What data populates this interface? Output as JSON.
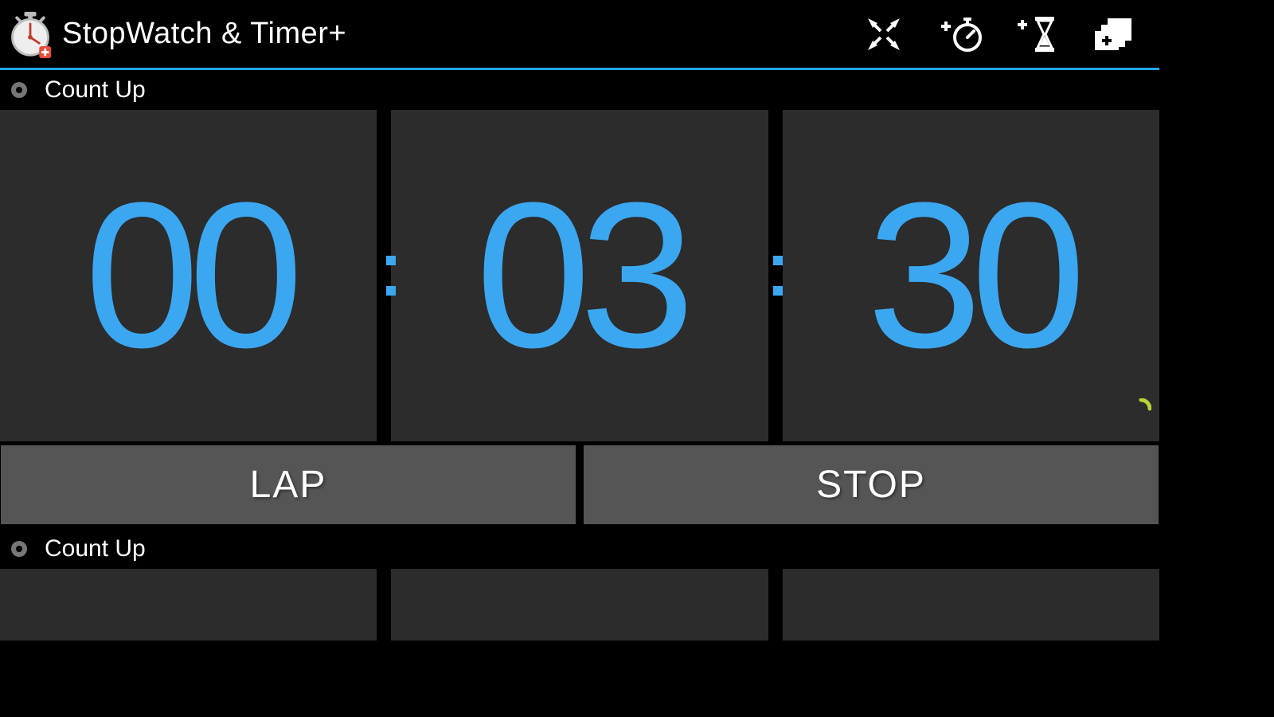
{
  "app": {
    "title": "StopWatch & Timer+",
    "accent": "#1fa6e8",
    "digit_color": "#3aa7f0"
  },
  "actions": {
    "collapse_icon": "collapse",
    "add_stopwatch_icon": "add-stopwatch",
    "add_timer_icon": "add-timer",
    "add_panel_icon": "add-panel"
  },
  "timers": [
    {
      "label": "Count Up",
      "hh": "00",
      "mm": "03",
      "ss": "30",
      "buttons": {
        "left": "LAP",
        "right": "STOP"
      }
    },
    {
      "label": "Count Up",
      "hh": "",
      "mm": "",
      "ss": ""
    }
  ]
}
